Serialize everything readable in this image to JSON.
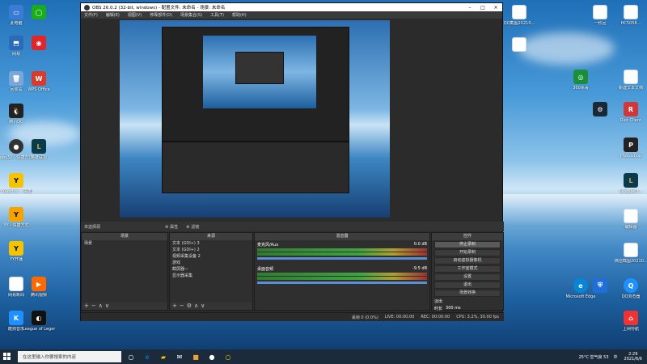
{
  "obs": {
    "title": "OBS 26.0.2 (32-bit, windows) - 配置文件: 未命名 - 场景: 未命名",
    "menu": [
      "文件(F)",
      "编辑(E)",
      "视图(V)",
      "停靠部件(D)",
      "场景集合(S)",
      "工具(T)",
      "帮助(H)"
    ],
    "status_line": "未选择源",
    "properties_btn": "属性",
    "filters_btn": "滤镜",
    "scenes_title": "场景",
    "scenes": [
      "场景"
    ],
    "sources_title": "来源",
    "sources": [
      "文本 (GDI+) 3",
      "文本 (GDI+) 2",
      "视频采集设备 2",
      "游戏",
      "截屏器—",
      "显示器采集"
    ],
    "mixer_title": "混音器",
    "mixer": [
      {
        "name": "麦克风/Aux",
        "db": "0.0 dB"
      },
      {
        "name": "桌面音频",
        "db": "-9.5 dB"
      }
    ],
    "transitions_label": "淡出",
    "duration_label": "时长",
    "duration_value": "300 ms",
    "controls_title": "控件",
    "controls": [
      "停止录制",
      "开始录制",
      "启动虚拟摄像机",
      "工作室模式",
      "设置",
      "退出"
    ],
    "scene_transitions_title": "场景转换",
    "status": {
      "dropped": "丢帧 0 (0.0%)",
      "live": "LIVE: 00:00:00",
      "rec": "REC: 00:00:00",
      "cpu": "CPU: 3.2%, 30.00 fps"
    }
  },
  "desktop_icons_left": [
    "此电脑",
    "网易",
    "回收站",
    "WPS Office",
    "腾讯QQ",
    "obs32 - 快捷方式",
    "英雄联盟",
    "YYAnchor - 快捷方式",
    "YY - 快捷方式",
    "YY开播",
    "网易新闻",
    "腾讯视频",
    "酷狗音乐",
    "League of Legends"
  ],
  "desktop_icons_right": [
    "QQ截图20210...",
    "一秒回",
    "HC5058...",
    "360杀毒",
    "新建文本文档",
    "Microsoft Edge",
    "Photoshop",
    "上网导航",
    "Riot Client",
    "QQ浏览器",
    "LeagueCl...",
    "编辑器",
    "微信截图20210..."
  ],
  "taskbar": {
    "search_placeholder": "在这里输入你要搜索的内容",
    "weather": "25°C 空气良 53",
    "time": "2:29",
    "date": "2021/6/6",
    "input_method": "中"
  },
  "colors": {
    "obs_bg": "#2b2b2b",
    "taskbar": "#1c2b3c",
    "accent": "#3da53d"
  }
}
